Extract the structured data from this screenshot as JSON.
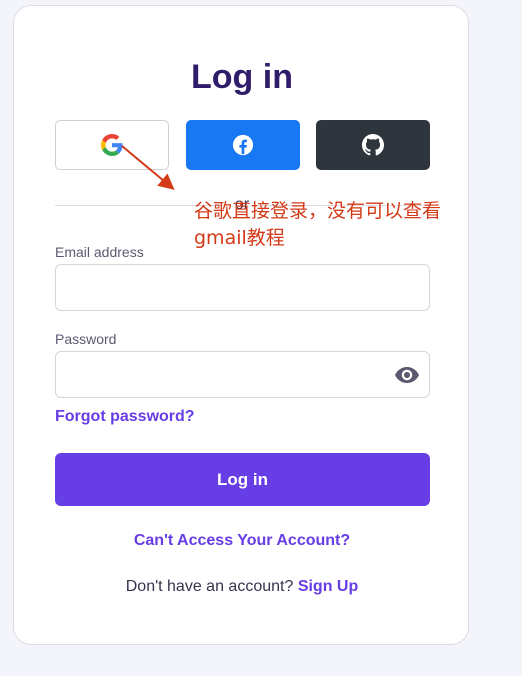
{
  "login_card": {
    "title": "Log in",
    "social": {
      "google_icon": "google-icon",
      "facebook_icon": "facebook-icon",
      "github_icon": "github-icon"
    },
    "divider_text": "or",
    "email": {
      "label": "Email address",
      "value": "",
      "placeholder": ""
    },
    "password": {
      "label": "Password",
      "value": "",
      "placeholder": "",
      "toggle_icon": "eye-icon"
    },
    "forgot_password": "Forgot password?",
    "submit_label": "Log in",
    "cant_access": "Can't Access Your Account?",
    "signup_prompt": "Don't have an account?",
    "signup_link": "Sign Up"
  },
  "annotation": {
    "text": "谷歌直接登录，没有可以查看gmail教程",
    "color": "#d33a17"
  },
  "colors": {
    "accent": "#673de6",
    "title": "#2f1c6a",
    "facebook": "#1877f2",
    "github": "#2f353d"
  }
}
